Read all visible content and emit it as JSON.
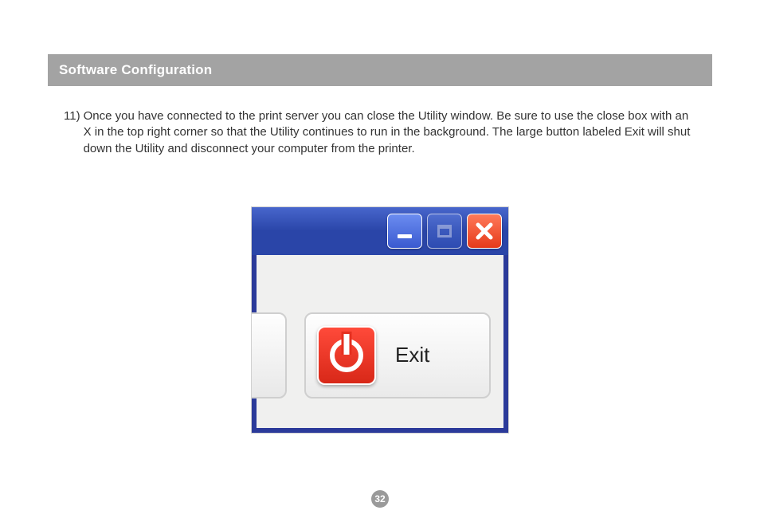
{
  "header": {
    "title": "Software Configuration"
  },
  "step": {
    "number": "11)",
    "text": "Once you have connected to the print server you can close the Utility window.  Be sure to use the close box with an X in the top right corner so that the Utility continues to run in the background.  The large button labeled Exit will shut down the Utility and disconnect your computer from the printer."
  },
  "figure": {
    "exit_label": "Exit"
  },
  "page_number": "32"
}
